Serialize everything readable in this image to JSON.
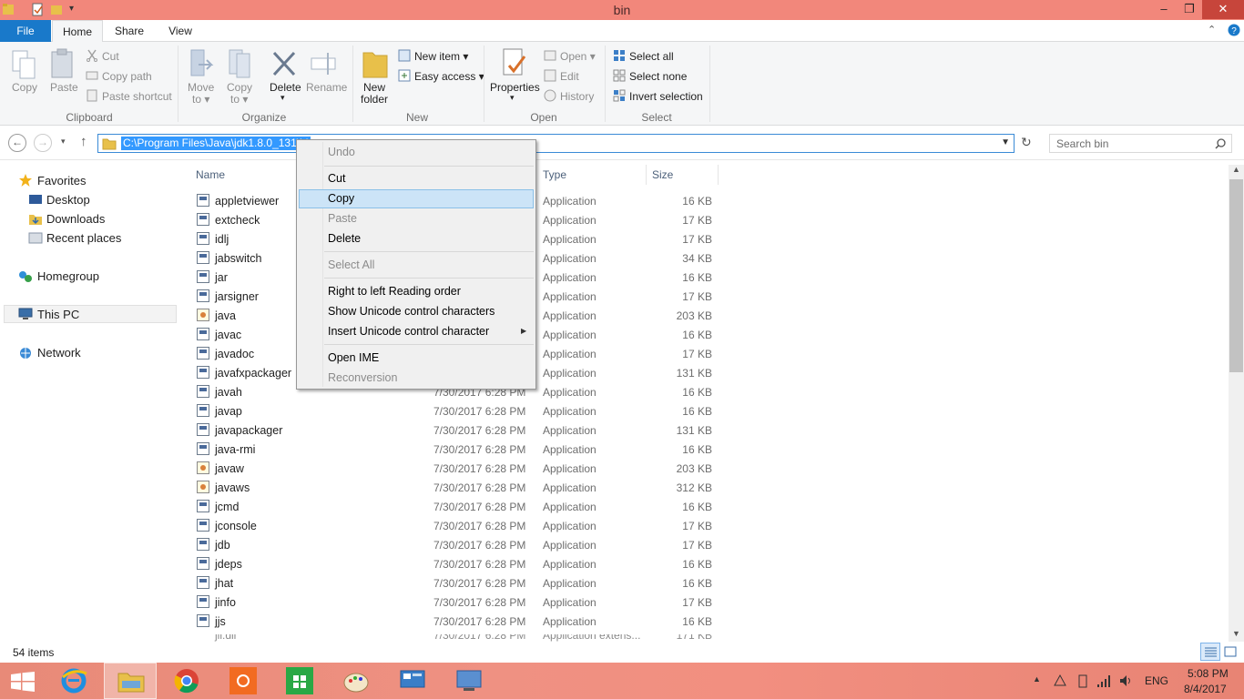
{
  "window": {
    "title": "bin",
    "minimize": "–",
    "maximize": "❐",
    "close": "✕"
  },
  "ribbon_tabs": {
    "file": "File",
    "home": "Home",
    "share": "Share",
    "view": "View"
  },
  "ribbon": {
    "clipboard": {
      "copy": "Copy",
      "paste": "Paste",
      "cut": "Cut",
      "copy_path": "Copy path",
      "paste_shortcut": "Paste shortcut",
      "group": "Clipboard"
    },
    "organize": {
      "move_to_1": "Move",
      "move_to_2": "to ▾",
      "copy_to_1": "Copy",
      "copy_to_2": "to ▾",
      "delete": "Delete",
      "rename": "Rename",
      "group": "Organize"
    },
    "new": {
      "new_folder_1": "New",
      "new_folder_2": "folder",
      "new_item": "New item ▾",
      "easy_access": "Easy access ▾",
      "group": "New"
    },
    "open": {
      "properties": "Properties",
      "open": "Open ▾",
      "edit": "Edit",
      "history": "History",
      "group": "Open"
    },
    "select": {
      "select_all": "Select all",
      "select_none": "Select none",
      "invert": "Invert selection",
      "group": "Select"
    }
  },
  "address": {
    "path": "C:\\Program Files\\Java\\jdk1.8.0_131\\bin",
    "search_placeholder": "Search bin"
  },
  "nav": {
    "favorites": "Favorites",
    "desktop": "Desktop",
    "downloads": "Downloads",
    "recent": "Recent places",
    "homegroup": "Homegroup",
    "thispc": "This PC",
    "network": "Network"
  },
  "columns": {
    "name": "Name",
    "type": "Type",
    "size": "Size"
  },
  "files": [
    {
      "name": "appletviewer",
      "date": "",
      "type": "Application",
      "size": "16 KB",
      "java": false
    },
    {
      "name": "extcheck",
      "date": "",
      "type": "Application",
      "size": "17 KB",
      "java": false
    },
    {
      "name": "idlj",
      "date": "",
      "type": "Application",
      "size": "17 KB",
      "java": false
    },
    {
      "name": "jabswitch",
      "date": "",
      "type": "Application",
      "size": "34 KB",
      "java": false
    },
    {
      "name": "jar",
      "date": "",
      "type": "Application",
      "size": "16 KB",
      "java": false
    },
    {
      "name": "jarsigner",
      "date": "",
      "type": "Application",
      "size": "17 KB",
      "java": false
    },
    {
      "name": "java",
      "date": "",
      "type": "Application",
      "size": "203 KB",
      "java": true
    },
    {
      "name": "javac",
      "date": "",
      "type": "Application",
      "size": "16 KB",
      "java": false
    },
    {
      "name": "javadoc",
      "date": "",
      "type": "Application",
      "size": "17 KB",
      "java": false
    },
    {
      "name": "javafxpackager",
      "date": "",
      "type": "Application",
      "size": "131 KB",
      "java": false
    },
    {
      "name": "javah",
      "date": "7/30/2017 6:28 PM",
      "type": "Application",
      "size": "16 KB",
      "java": false
    },
    {
      "name": "javap",
      "date": "7/30/2017 6:28 PM",
      "type": "Application",
      "size": "16 KB",
      "java": false
    },
    {
      "name": "javapackager",
      "date": "7/30/2017 6:28 PM",
      "type": "Application",
      "size": "131 KB",
      "java": false
    },
    {
      "name": "java-rmi",
      "date": "7/30/2017 6:28 PM",
      "type": "Application",
      "size": "16 KB",
      "java": false
    },
    {
      "name": "javaw",
      "date": "7/30/2017 6:28 PM",
      "type": "Application",
      "size": "203 KB",
      "java": true
    },
    {
      "name": "javaws",
      "date": "7/30/2017 6:28 PM",
      "type": "Application",
      "size": "312 KB",
      "java": true
    },
    {
      "name": "jcmd",
      "date": "7/30/2017 6:28 PM",
      "type": "Application",
      "size": "16 KB",
      "java": false
    },
    {
      "name": "jconsole",
      "date": "7/30/2017 6:28 PM",
      "type": "Application",
      "size": "17 KB",
      "java": false
    },
    {
      "name": "jdb",
      "date": "7/30/2017 6:28 PM",
      "type": "Application",
      "size": "17 KB",
      "java": false
    },
    {
      "name": "jdeps",
      "date": "7/30/2017 6:28 PM",
      "type": "Application",
      "size": "16 KB",
      "java": false
    },
    {
      "name": "jhat",
      "date": "7/30/2017 6:28 PM",
      "type": "Application",
      "size": "16 KB",
      "java": false
    },
    {
      "name": "jinfo",
      "date": "7/30/2017 6:28 PM",
      "type": "Application",
      "size": "17 KB",
      "java": false
    },
    {
      "name": "jjs",
      "date": "7/30/2017 6:28 PM",
      "type": "Application",
      "size": "16 KB",
      "java": false
    }
  ],
  "status": {
    "count": "54 items"
  },
  "context_menu": {
    "undo": "Undo",
    "cut": "Cut",
    "copy": "Copy",
    "paste": "Paste",
    "delete": "Delete",
    "select_all": "Select All",
    "rtl": "Right to left Reading order",
    "show_unicode": "Show Unicode control characters",
    "insert_unicode": "Insert Unicode control character",
    "open_ime": "Open IME",
    "reconversion": "Reconversion"
  },
  "taskbar": {
    "lang": "ENG",
    "time": "5:08 PM",
    "date": "8/4/2017"
  },
  "colors": {
    "title_bar": "#f2877b",
    "accent": "#1979ca",
    "selection": "#3399ff",
    "menu_highlight": "#cce4f7"
  }
}
